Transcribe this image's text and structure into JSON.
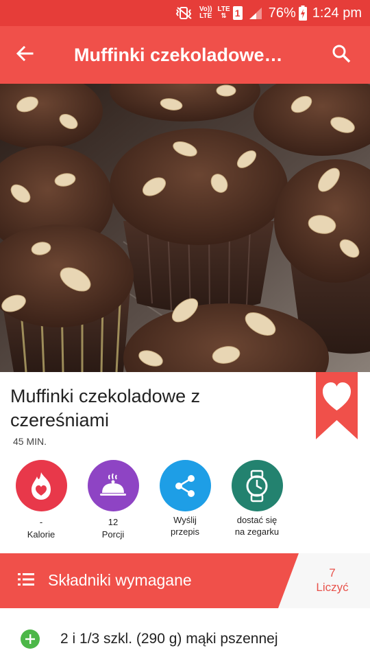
{
  "status_bar": {
    "volte_label": "Vo))",
    "volte_sub": "LTE",
    "lte_label": "LTE",
    "sim_slot": "1",
    "battery": "76%",
    "time": "1:24 pm",
    "icons": [
      "mute-vibrate-icon",
      "signal-icon",
      "battery-charging-icon"
    ]
  },
  "app_bar": {
    "title": "Muffinki czekoladowe…",
    "back_icon": "arrow-back-icon",
    "search_icon": "search-icon"
  },
  "hero": {
    "image": "chocolate muffins with almonds"
  },
  "recipe": {
    "title": "Muffinki czekoladowe z czereśniami",
    "time": "45 MIN.",
    "favorite_icon": "heart-icon"
  },
  "stats": [
    {
      "icon": "flame-heart-icon",
      "value": "-",
      "label": "Kalorie",
      "color": "#e8384a"
    },
    {
      "icon": "serving-cloche-icon",
      "value": "12",
      "label": "Porcji",
      "color": "#8e44c4"
    },
    {
      "icon": "share-icon",
      "value": "Wyślij",
      "label": "przepis",
      "color": "#1e9ee6"
    },
    {
      "icon": "watch-icon",
      "value": "dostać się",
      "label": "na zegarku",
      "color": "#23826f"
    }
  ],
  "ingredients_header": {
    "label": "Składniki wymagane",
    "count": "7",
    "count_label": "Liczyć",
    "icon": "list-icon"
  },
  "ingredients": [
    {
      "text": "2 i 1/3 szkl. (290 g) mąki pszennej",
      "icon": "add-icon"
    }
  ],
  "colors": {
    "status_bar": "#e63d39",
    "app_bar": "#f0504a",
    "accent": "#f0504a",
    "add_green": "#4cb748"
  }
}
